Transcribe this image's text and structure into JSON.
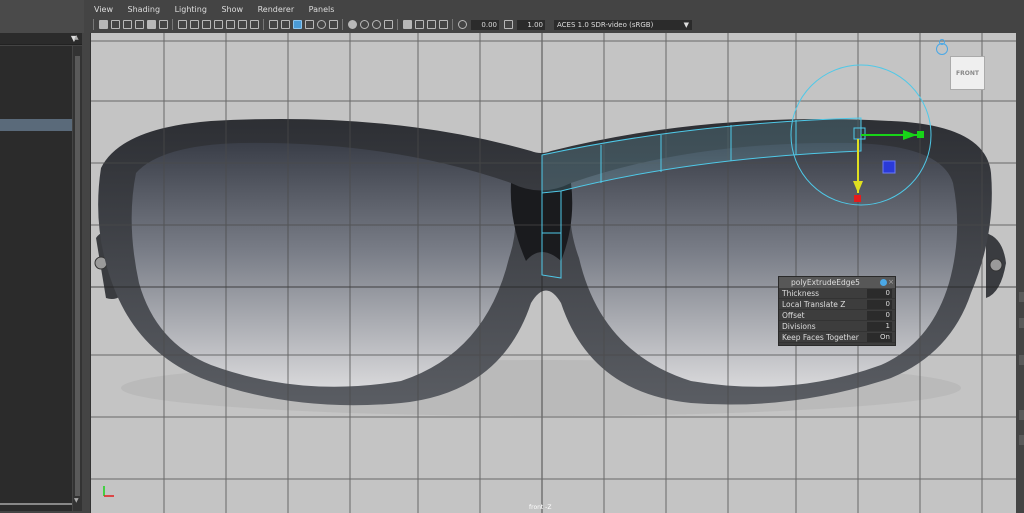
{
  "panel_menu": [
    "View",
    "Shading",
    "Lighting",
    "Show",
    "Renderer",
    "Panels"
  ],
  "toolbar": {
    "exposure_value": "0.00",
    "gamma_value": "1.00",
    "color_space": "ACES 1.0 SDR-video (sRGB)"
  },
  "view_cube_label": "FRONT",
  "view_name": "front -Z",
  "extrude_box": {
    "title": "polyExtrudeEdge5",
    "rows": [
      {
        "label": "Thickness",
        "value": "0"
      },
      {
        "label": "Local Translate Z",
        "value": "0"
      },
      {
        "label": "Offset",
        "value": "0"
      },
      {
        "label": "Divisions",
        "value": "1"
      },
      {
        "label": "Keep Faces Together",
        "value": "On"
      }
    ]
  },
  "colors": {
    "viewport_bg": "#c4c4c4",
    "grid": "#4a4a4a",
    "selection_wire": "#4fc9e8",
    "gizmo_x": "#18d418",
    "gizmo_y": "#e0e020",
    "gizmo_z": "#2a3ad8",
    "gizmo_red": "#e41c1c"
  },
  "icons": {
    "camera": "camera-icon",
    "grid": "grid-icon",
    "wireframe": "wireframe-icon",
    "smooth_shade": "smooth-shade-icon",
    "textured": "texture-icon",
    "lights": "light-icon",
    "isolate": "isolate-icon",
    "xray": "xray-icon"
  }
}
